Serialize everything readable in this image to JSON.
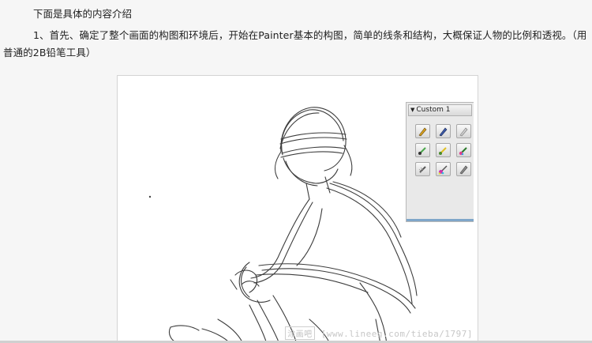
{
  "intro": "下面是具体的内容介绍",
  "paragraph": "1、首先、确定了整个画面的构图和环境后，开始在Painter基本的构图，简单的线条和结构，大概保证人物的比例和透视。（用普通的2B铅笔工具）",
  "palette": {
    "title": "Custom 1",
    "tools": [
      {
        "name": "pencil-tool-icon",
        "color": "#d8a21e"
      },
      {
        "name": "pen-tool-icon",
        "color": "#3c5aa8"
      },
      {
        "name": "eraser-pencil-tool-icon",
        "color": "#b8b8b8"
      },
      {
        "name": "brush-tool-icon",
        "color": "#4aa84a"
      },
      {
        "name": "yellow-brush-tool-icon",
        "color": "#e0c020"
      },
      {
        "name": "rainbow-brush-tool-icon",
        "color": "#e04090"
      },
      {
        "name": "airbrush-tool-icon",
        "color": "#555555"
      },
      {
        "name": "color-mixer-tool-icon",
        "color": "#d030b0"
      },
      {
        "name": "blender-tool-icon",
        "color": "#777777"
      }
    ]
  },
  "watermark": {
    "logo": "涂画吧",
    "url": "[www.lineeg.com/tieba/1797]"
  }
}
